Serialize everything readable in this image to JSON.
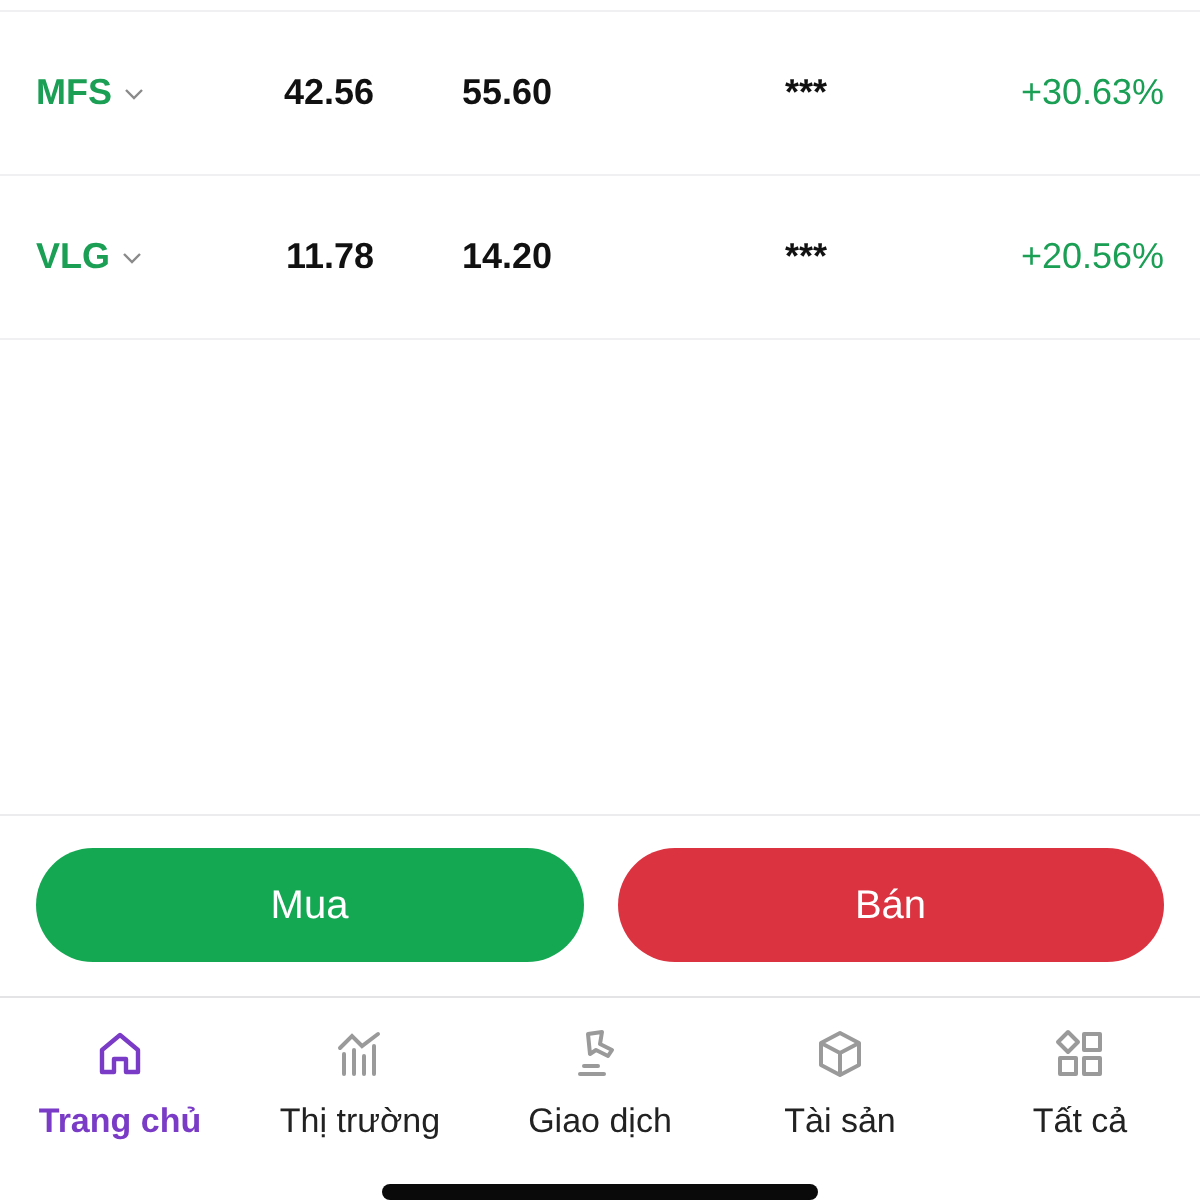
{
  "rows": [
    {
      "ticker": "MFS",
      "col_2": "42.56",
      "col_3": "55.60",
      "col_4": "***",
      "change": "+30.63%"
    },
    {
      "ticker": "VLG",
      "col_2": "11.78",
      "col_3": "14.20",
      "col_4": "***",
      "change": "+20.56%"
    }
  ],
  "actions": [
    {
      "label": "Mua",
      "kind": "buy"
    },
    {
      "label": "Bán",
      "kind": "sell"
    }
  ],
  "nav": [
    {
      "label": "Trang chủ",
      "selected": true
    },
    {
      "label": "Thị trường",
      "selected": false
    },
    {
      "label": "Giao dịch",
      "selected": false
    },
    {
      "label": "Tài sản",
      "selected": false
    },
    {
      "label": "Tất cả",
      "selected": false
    }
  ]
}
